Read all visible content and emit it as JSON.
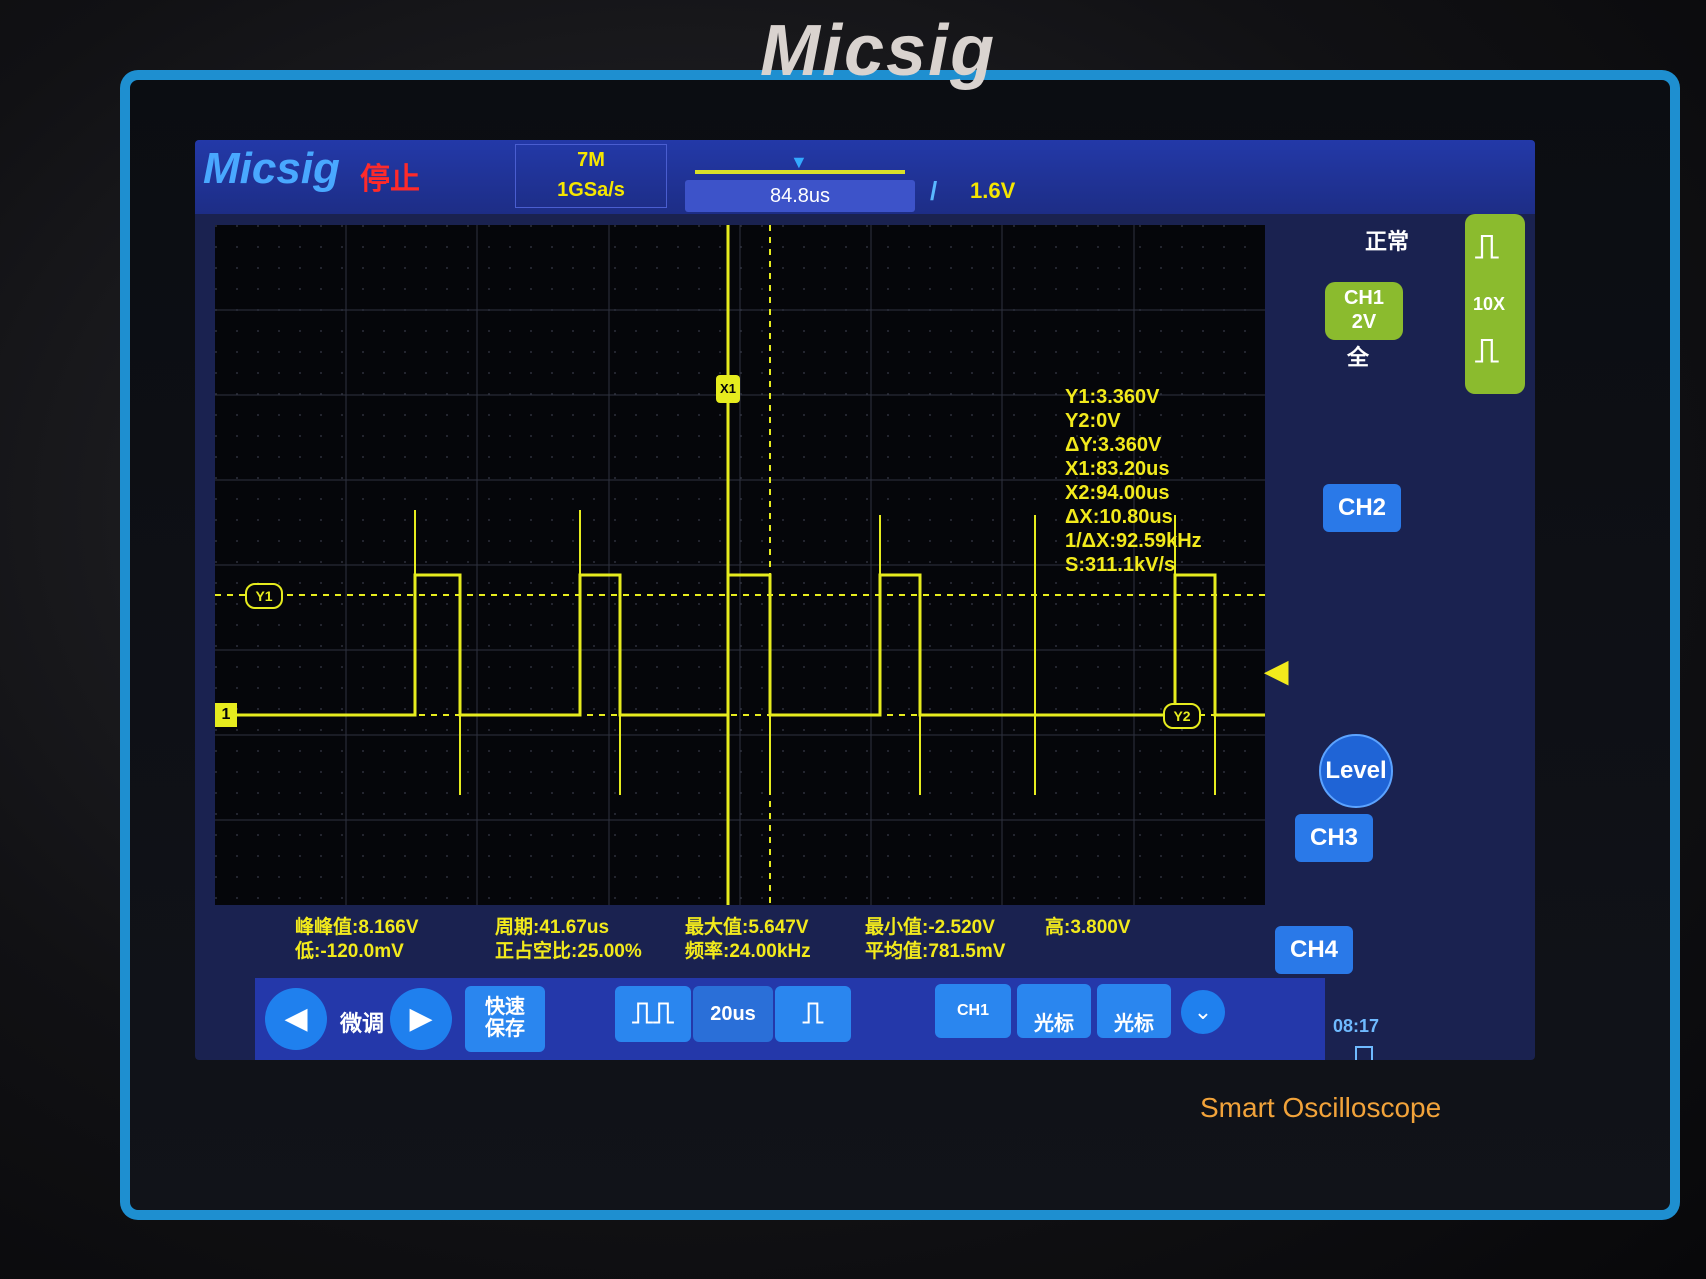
{
  "bezel": {
    "brand": "Micsig",
    "product": "Smart Oscilloscope"
  },
  "header": {
    "logo": "Micsig",
    "run_state": "停止",
    "memory_depth": "7M",
    "sample_rate": "1GSa/s",
    "time_offset": "84.8us",
    "trigger_level": "␸1.6V"
  },
  "cursors": {
    "y1": "Y1:3.360V",
    "y2": "Y2:0V",
    "dy": "ΔY:3.360V",
    "x1": "X1:83.20us",
    "x2": "X2:94.00us",
    "dx": "ΔX:10.80us",
    "inv_dx": "1/ΔX:92.59kHz",
    "slope": "S:311.1kV/s",
    "y1_tag": "Y1",
    "y2_tag": "Y2",
    "x1_tag": "X1",
    "ch_marker": "1"
  },
  "right_panel": {
    "acq_mode": "正常",
    "probe": "10X",
    "ch1_label": "CH1",
    "ch1_scale": "2V",
    "bandwidth": "全",
    "ch2": "CH2",
    "ch3": "CH3",
    "ch4": "CH4",
    "level": "Level",
    "clock": "08:17"
  },
  "measurements": {
    "pk_pk": "峰峰值:8.166V",
    "low": "低:-120.0mV",
    "period": "周期:41.67us",
    "duty": "正占空比:25.00%",
    "max": "最大值:5.647V",
    "freq": "频率:24.00kHz",
    "min": "最小值:-2.520V",
    "avg": "平均值:781.5mV",
    "high": "高:3.800V"
  },
  "bottom_bar": {
    "fine": "微调",
    "quick_save_1": "快速",
    "quick_save_2": "保存",
    "timebase": "20us",
    "ch_select": "CH1",
    "cursor_h": "光标",
    "cursor_v": "光标"
  },
  "colors": {
    "trace": "#e6ec1e",
    "accent": "#2a86ef",
    "bezel": "#1e8fd0"
  }
}
